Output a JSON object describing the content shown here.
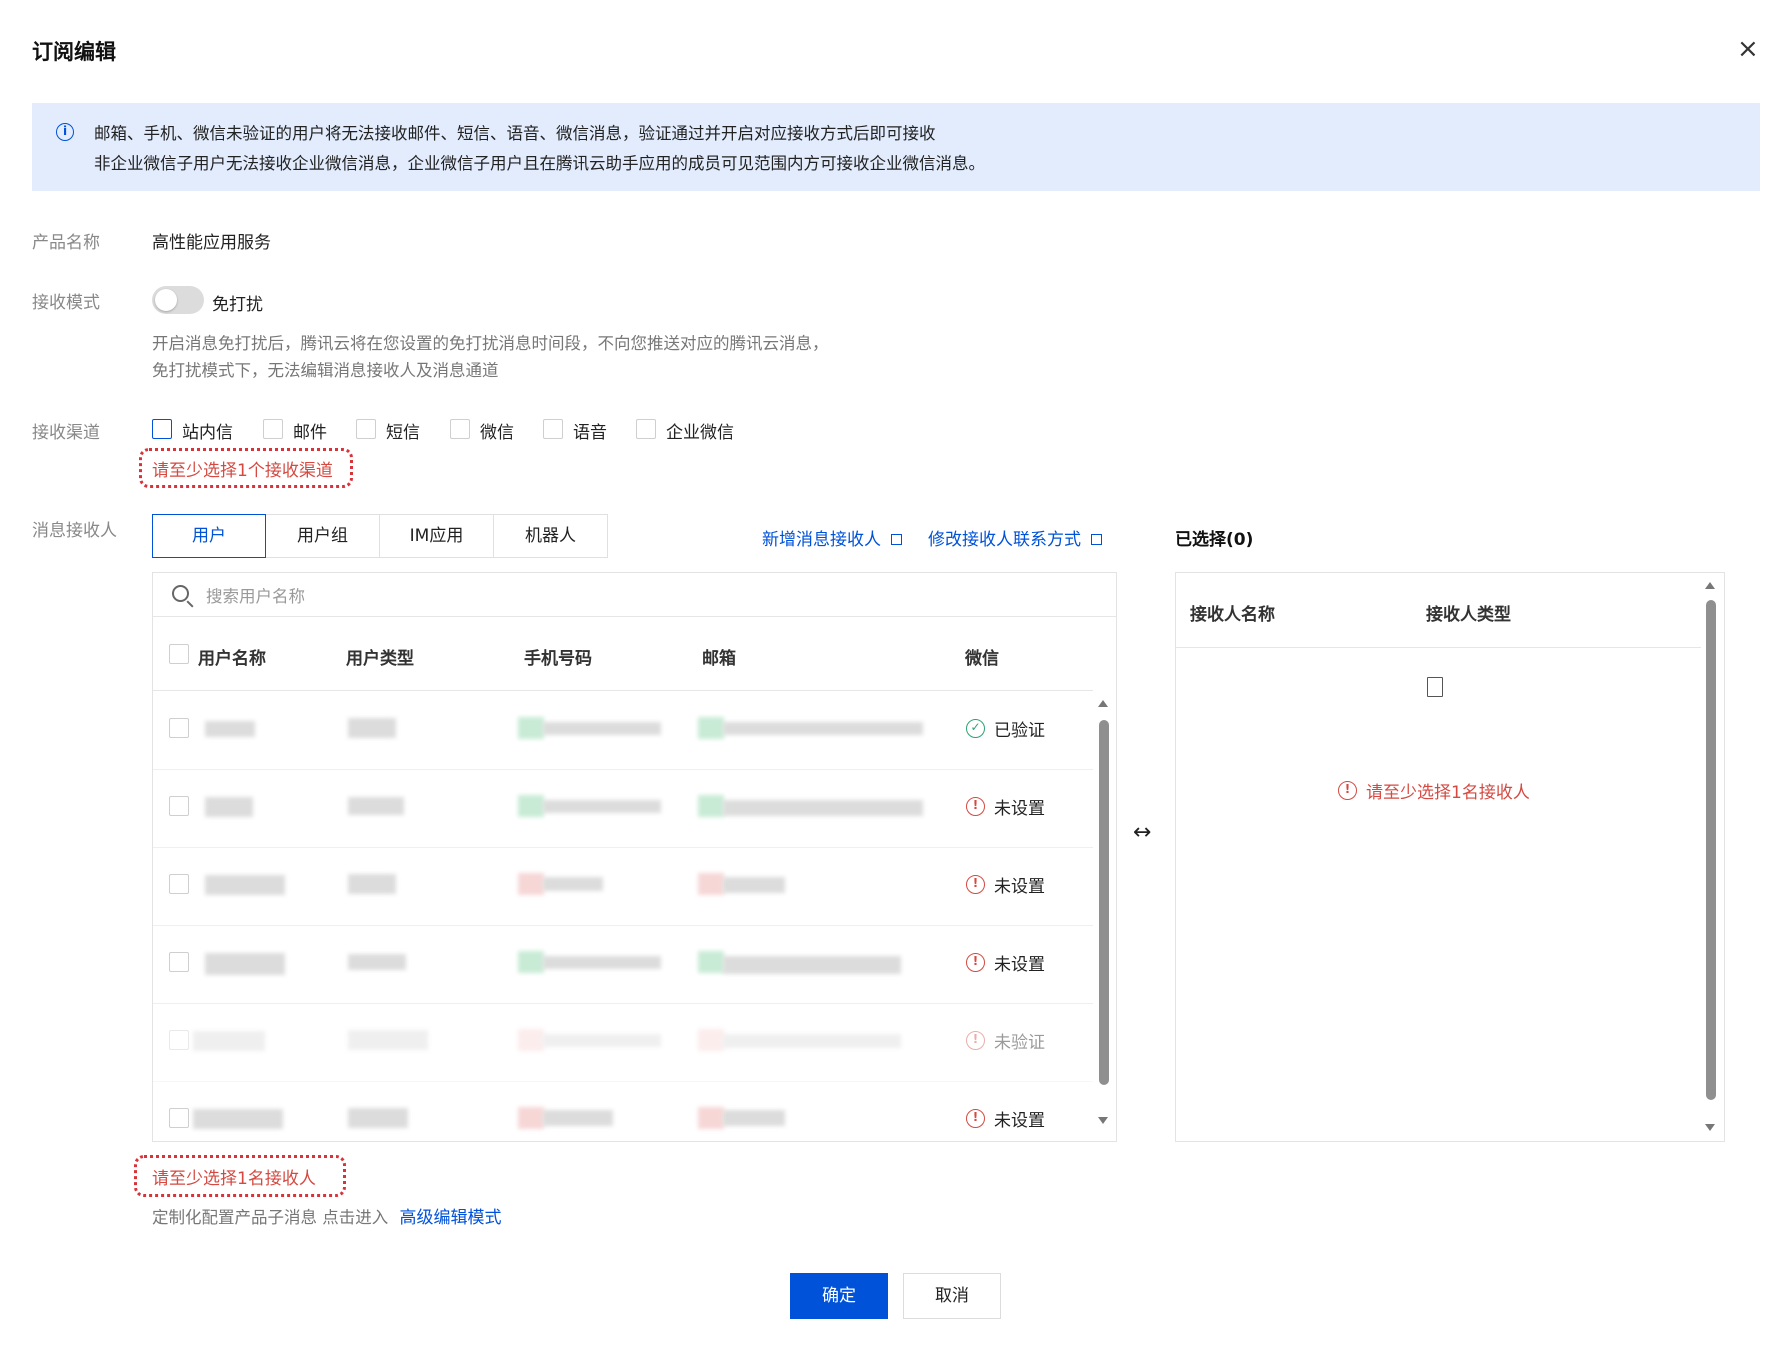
{
  "dialog": {
    "title": "订阅编辑",
    "close_icon": "×"
  },
  "notice": {
    "icon": "i",
    "line1": "邮箱、手机、微信未验证的用户将无法接收邮件、短信、语音、微信消息，验证通过并开启对应接收方式后即可接收",
    "line2": "非企业微信子用户无法接收企业微信消息，企业微信子用户且在腾讯云助手应用的成员可见范围内方可接收企业微信消息。"
  },
  "product": {
    "label": "产品名称",
    "value": "高性能应用服务"
  },
  "mode": {
    "label": "接收模式",
    "toggle_label": "免打扰",
    "toggle_on": false,
    "hint1": "开启消息免打扰后，腾讯云将在您设置的免打扰消息时间段，不向您推送对应的腾讯云消息，",
    "hint2": "免打扰模式下，无法编辑消息接收人及消息通道"
  },
  "channels": {
    "label": "接收渠道",
    "options": [
      "站内信",
      "邮件",
      "短信",
      "微信",
      "语音",
      "企业微信"
    ],
    "error": "请至少选择1个接收渠道"
  },
  "recipients": {
    "label": "消息接收人",
    "tabs": [
      "用户",
      "用户组",
      "IM应用",
      "机器人"
    ],
    "active_tab": "用户",
    "add_link": "新增消息接收人",
    "modify_link": "修改接收人联系方式",
    "search_placeholder": "搜索用户名称",
    "columns": [
      "用户名称",
      "用户类型",
      "手机号码",
      "邮箱",
      "微信"
    ],
    "rows": [
      {
        "wechat_status": "已验证"
      },
      {
        "wechat_status": "未设置"
      },
      {
        "wechat_status": "未设置"
      },
      {
        "wechat_status": "未设置"
      },
      {
        "wechat_status": "未验证"
      },
      {
        "wechat_status": "未设置"
      }
    ],
    "error": "请至少选择1名接收人",
    "footer_text": "定制化配置产品子消息 点击进入",
    "footer_link": "高级编辑模式"
  },
  "transfer_icon": "↔",
  "selected": {
    "title": "已选择(0)",
    "columns": [
      "接收人名称",
      "接收人类型"
    ],
    "empty_error": "请至少选择1名接收人"
  },
  "footer": {
    "confirm": "确定",
    "cancel": "取消"
  },
  "colors": {
    "primary": "#0052d9",
    "error": "#d54941",
    "success": "#2ba471",
    "notice_bg": "#e2ecfd"
  }
}
